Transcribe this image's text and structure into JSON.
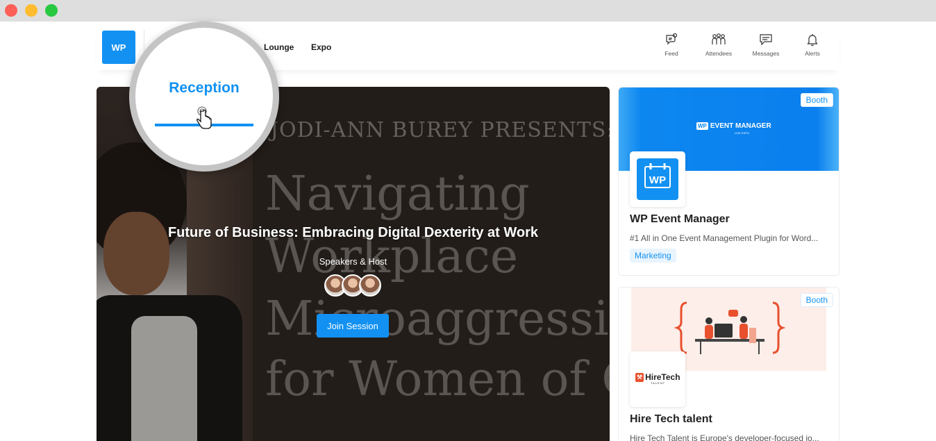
{
  "window": {
    "controls": [
      "close",
      "minimize",
      "maximize"
    ]
  },
  "header": {
    "logo_text": "WP",
    "nav": [
      {
        "label": "Reception",
        "active": true
      },
      {
        "label": "Lounge"
      },
      {
        "label": "Expo"
      }
    ],
    "icons": [
      {
        "label": "Feed",
        "icon": "feed-icon"
      },
      {
        "label": "Attendees",
        "icon": "attendees-icon"
      },
      {
        "label": "Messages",
        "icon": "messages-icon"
      },
      {
        "label": "Alerts",
        "icon": "bell-icon"
      }
    ]
  },
  "hero": {
    "background_text": {
      "presenter": "JODI-ANN BUREY PRESENTS:",
      "lines": [
        "Navigating",
        "Workplace",
        "Microaggressio",
        "for Women of C"
      ]
    },
    "title": "Future of Business: Embracing Digital Dexterity at Work",
    "speakers_label": "Speakers & Host",
    "speaker_count": 3,
    "join_label": "Join Session"
  },
  "booths": [
    {
      "badge": "Booth",
      "banner_brand": "EVENT MANAGER",
      "banner_brand_mark": "WP",
      "banner_brand_sub": "LIVE EXPO",
      "logo_text": "WP",
      "name": "WP Event Manager",
      "description": "#1 All in One Event Management Plugin for Word...",
      "tag": "Marketing"
    },
    {
      "badge": "Booth",
      "logo_text": "HireTech",
      "logo_sub": "TALENT",
      "name": "Hire Tech talent",
      "description": "Hire Tech Talent is Europe's developer-focused jo..."
    }
  ],
  "colors": {
    "accent": "#1291f2",
    "hiretech": "#e8502e"
  }
}
